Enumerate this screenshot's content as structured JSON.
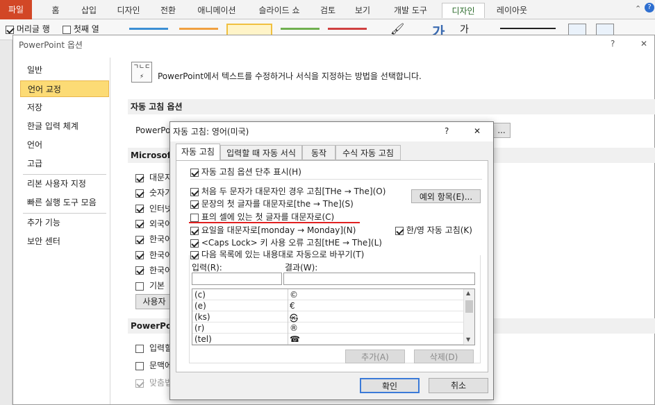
{
  "ribbon": {
    "tabs": [
      "파일",
      "홈",
      "삽입",
      "디자인",
      "전환",
      "애니메이션",
      "슬라이드 쇼",
      "검토",
      "보기",
      "개발 도구",
      "디자인",
      "레이아웃"
    ],
    "chk_header_row": "머리글 행",
    "chk_first_col": "첫째 열"
  },
  "options": {
    "title": "PowerPoint 옵션",
    "help": "?",
    "close": "✕",
    "nav": [
      "일반",
      "언어 교정",
      "저장",
      "한글 입력 체계",
      "언어",
      "고급",
      "리본 사용자 지정",
      "빠른 실행 도구 모음",
      "추가 기능",
      "보안 센터"
    ],
    "intro": "PowerPoint에서 텍스트를 수정하거나 서식을 지정하는 방법을 선택합니다.",
    "sec_autocorrect": "자동 고침 옵션",
    "autocorrect_label": "PowerPoi",
    "autocorrect_btn": "...",
    "sec_microsoft": "Microsoft",
    "ms_items": [
      "대문자",
      "숫자가",
      "인터넷",
      "외국어",
      "한국어",
      "한국어",
      "한국어",
      "기본"
    ],
    "ms_checked": [
      true,
      true,
      true,
      true,
      true,
      true,
      true,
      false
    ],
    "user_btn": "사용자",
    "sec_powerpoint": "PowerPoin",
    "pp_items": [
      "입력할",
      "문맥에",
      "맞춤법"
    ],
    "pp_checked": [
      false,
      false,
      true
    ]
  },
  "dialog": {
    "title": "자동 고침: 영어(미국)",
    "help": "?",
    "close": "✕",
    "tabs": [
      "자동 고침",
      "입력할 때 자동 서식",
      "동작",
      "수식 자동 고침"
    ],
    "show_buttons": "자동 고침 옵션 단추 표시(H)",
    "two_initial": "처음 두 문자가 대문자인 경우 고침[THe → The](O)",
    "exceptions_btn": "예외 항목(E)...",
    "first_sentence": "문장의 첫 글자를 대문자로[the → The](S)",
    "table_cell": "표의 셀에 있는 첫 글자를 대문자로(C)",
    "days": "요일을 대문자로[monday → Monday](N)",
    "hanyoung": "한/영 자동 고침(K)",
    "capslock": "<Caps Lock> 키 사용 오류 고침[tHE → The](L)",
    "replace_text": "다음 목록에 있는 내용대로 자동으로 바꾸기(T)",
    "input_label": "입력(R):",
    "result_label": "결과(W):",
    "list": [
      {
        "k": "(c)",
        "v": "©"
      },
      {
        "k": "(e)",
        "v": "€"
      },
      {
        "k": "(ks)",
        "v": "㉿"
      },
      {
        "k": "(r)",
        "v": "®"
      },
      {
        "k": "(tel)",
        "v": "☎"
      }
    ],
    "add_btn": "추가(A)",
    "delete_btn": "삭제(D)",
    "ok_btn": "확인",
    "cancel_btn": "취소"
  },
  "colors": {
    "file_tab": "#d24726",
    "selected_nav": "#fcdb75",
    "underline": "#e02020"
  }
}
